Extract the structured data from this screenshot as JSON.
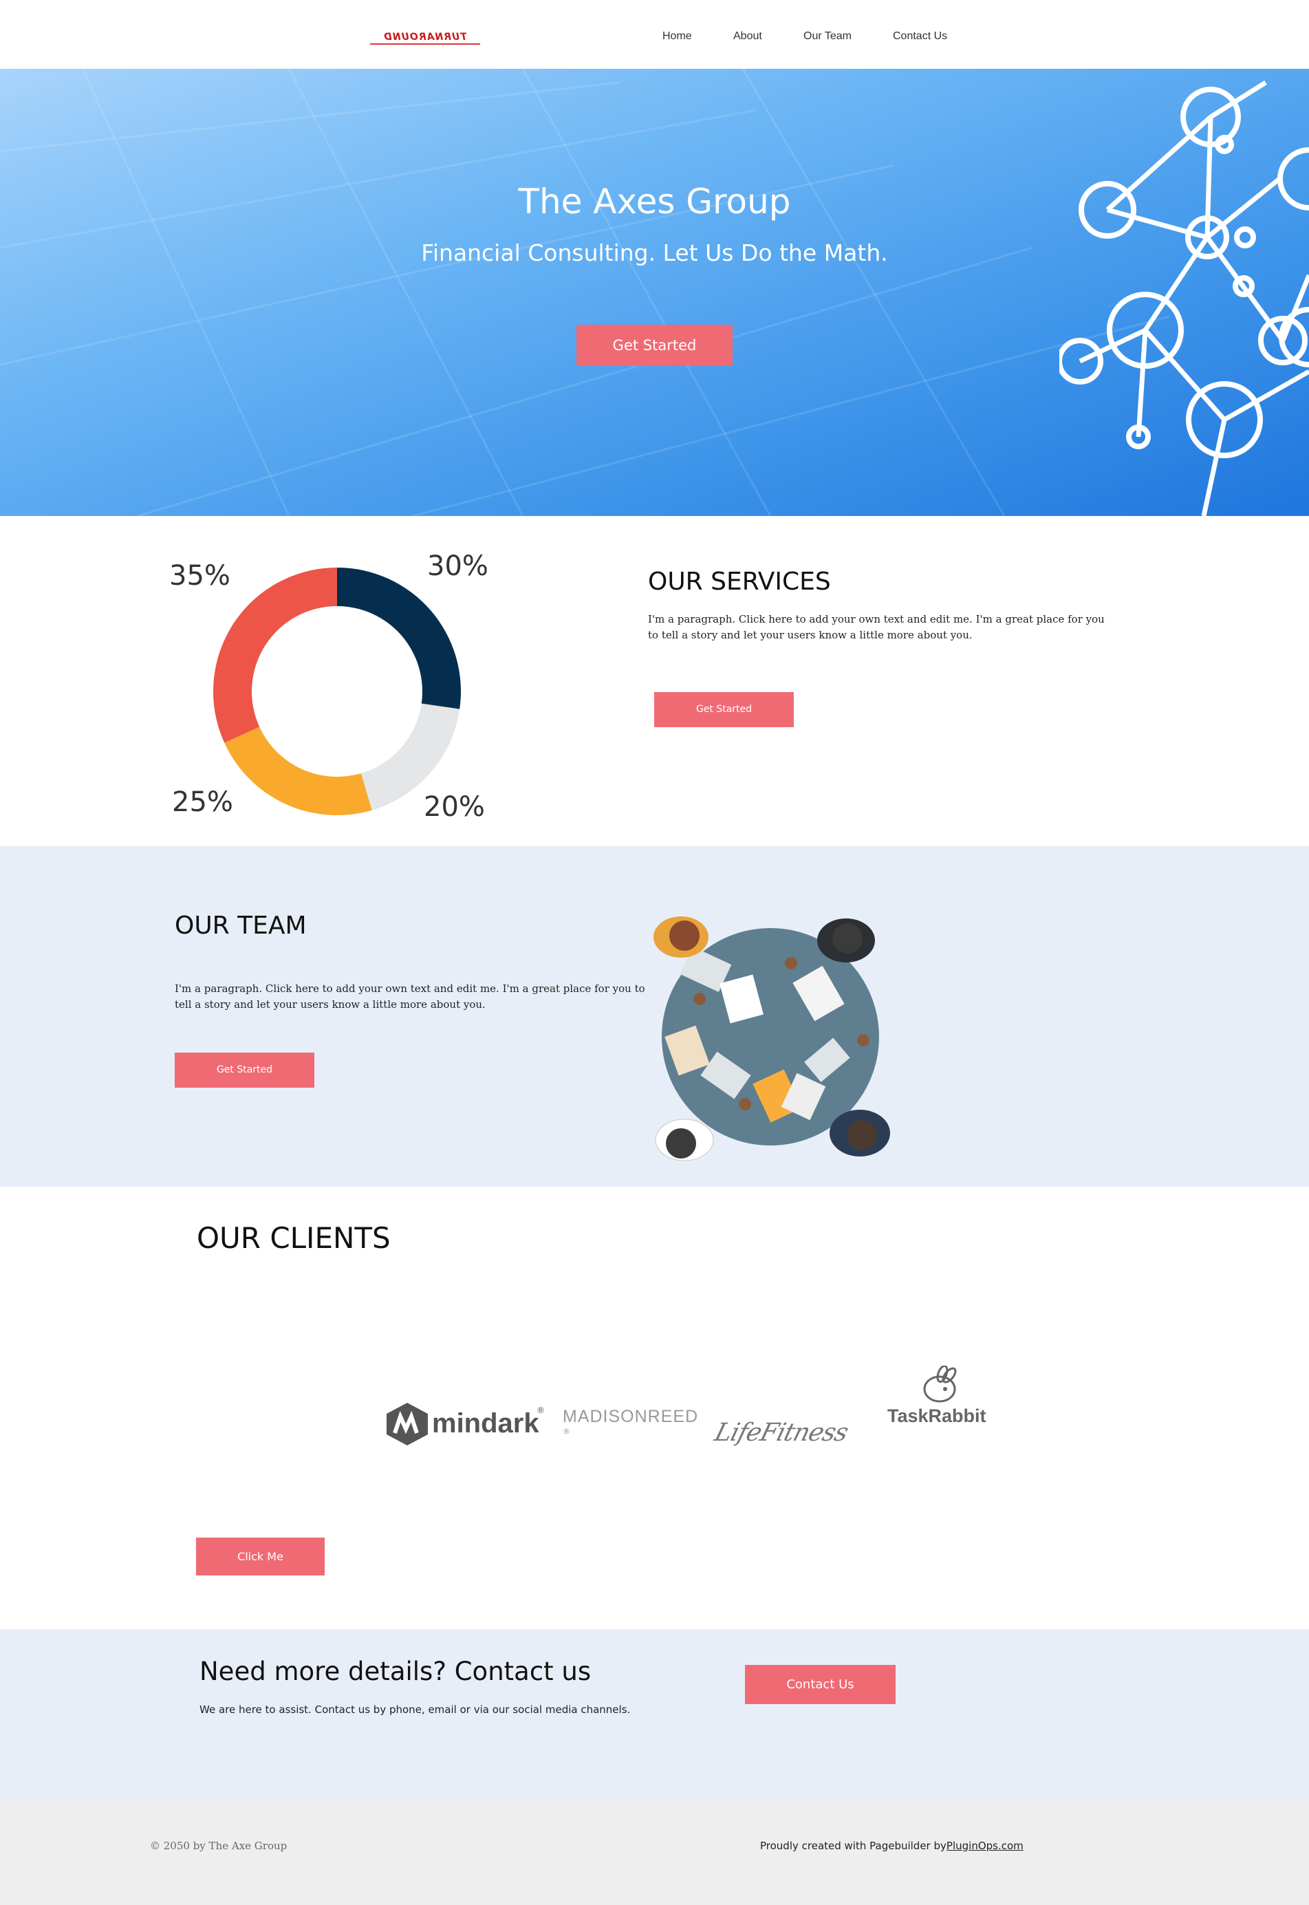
{
  "header": {
    "logo_text": "TURNAROUND",
    "nav": [
      "Home",
      "About",
      "Our Team",
      "Contact Us"
    ]
  },
  "hero": {
    "title": "The Axes Group",
    "subtitle": "Financial Consulting.  Let Us Do the Math.",
    "cta": "Get Started"
  },
  "services": {
    "title": "OUR SERVICES",
    "paragraph_line1": "I'm a paragraph. Click here to add your own text and edit me. I'm a great place for you",
    "paragraph_line2": "to tell a story and let your users know a little more about you.",
    "cta": "Get Started",
    "donut_labels": [
      "30%",
      "20%",
      "25%",
      "35%"
    ]
  },
  "chart_data": {
    "type": "pie",
    "categories": [
      "",
      "",
      "",
      ""
    ],
    "values": [
      30,
      20,
      25,
      35
    ],
    "colors": [
      "#052e4e",
      "#e4e6e8",
      "#f9aa2c",
      "#ec5547"
    ]
  },
  "team": {
    "title": "OUR TEAM",
    "paragraph_line1": "I'm a paragraph. Click here to add your own text and edit me. I'm a great place for you to",
    "paragraph_line2": "tell a story and let your users know a little more about you.",
    "cta": "Get Started"
  },
  "clients": {
    "title": "OUR CLIENTS",
    "logos": [
      "mindark",
      "MADISONREED",
      "LifeFitness",
      "TaskRabbit"
    ],
    "mindark_mark": "®",
    "madison_mark": "®",
    "cta": "Click Me"
  },
  "contact": {
    "title": "Need more details? Contact us",
    "text": "We are here to assist. Contact us by phone, email or via our social media channels.",
    "cta": "Contact Us"
  },
  "footer": {
    "copyright": "© 2050 by The Axe Group",
    "credit_prefix": "Proudly created with Pagebuilder by",
    "credit_link": "PluginOps.com"
  }
}
